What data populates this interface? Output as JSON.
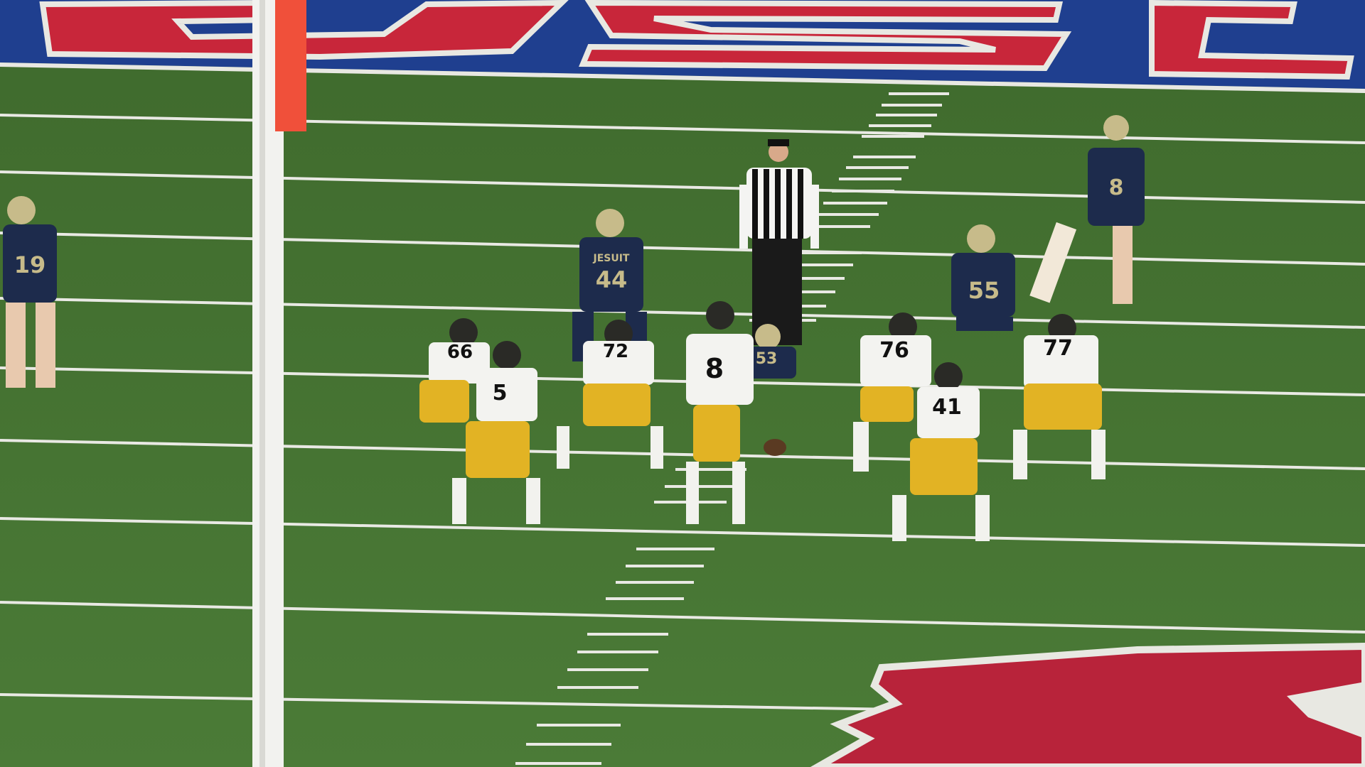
{
  "scene": {
    "endzone_lettering": "LSU",
    "colors": {
      "turf": "#4a7636",
      "turf_dark": "#3e6a2c",
      "endzone_blue": "#1f3f8f",
      "endzone_red": "#c8263a",
      "yard_line": "#e9e9e4",
      "home_jersey_navy": "#1d2b4c",
      "away_jersey_white": "#f3f3f0",
      "away_pants_gold": "#e2b324",
      "pylon_orange": "#f0503a"
    },
    "away_players": [
      {
        "number": "66",
        "role": "left-guard"
      },
      {
        "number": "5",
        "role": "slot-back"
      },
      {
        "number": "72",
        "role": "center"
      },
      {
        "number": "8",
        "role": "quarterback"
      },
      {
        "number": "76",
        "role": "right-guard"
      },
      {
        "number": "41",
        "role": "tight-end"
      },
      {
        "number": "77",
        "role": "right-tackle"
      }
    ],
    "home_players": [
      {
        "number": "19",
        "role": "cornerback"
      },
      {
        "number": "44",
        "role": "linebacker"
      },
      {
        "number": "55",
        "role": "linebacker"
      },
      {
        "number": "53",
        "role": "defensive-tackle"
      },
      {
        "number": "8",
        "role": "safety"
      }
    ],
    "home_jersey_wordmark": "JESUIT"
  }
}
